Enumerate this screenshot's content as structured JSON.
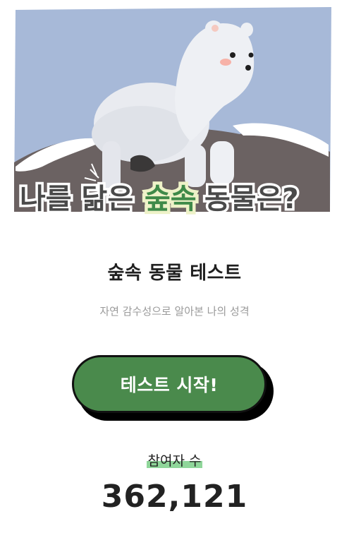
{
  "hero": {
    "headline_part1": "나를 닮은 ",
    "headline_highlight": "숲속",
    "headline_part2": " 동물은?",
    "colors": {
      "sky": "#a7b9d8",
      "ground": "#6b6262",
      "snow": "#ffffff",
      "headline_fill": "#4a4a4a",
      "highlight_fill": "#eef2c8",
      "highlight_text": "#3f8a49"
    }
  },
  "title": "숲속 동물 테스트",
  "subtitle": "자연 감수성으로 알아본 나의 성격",
  "start_button": {
    "label": "테스트 시작!",
    "color": "#4a8a4c"
  },
  "participants": {
    "label": "참여자 수",
    "count": "362,121",
    "highlight_color": "#8fd69a"
  }
}
